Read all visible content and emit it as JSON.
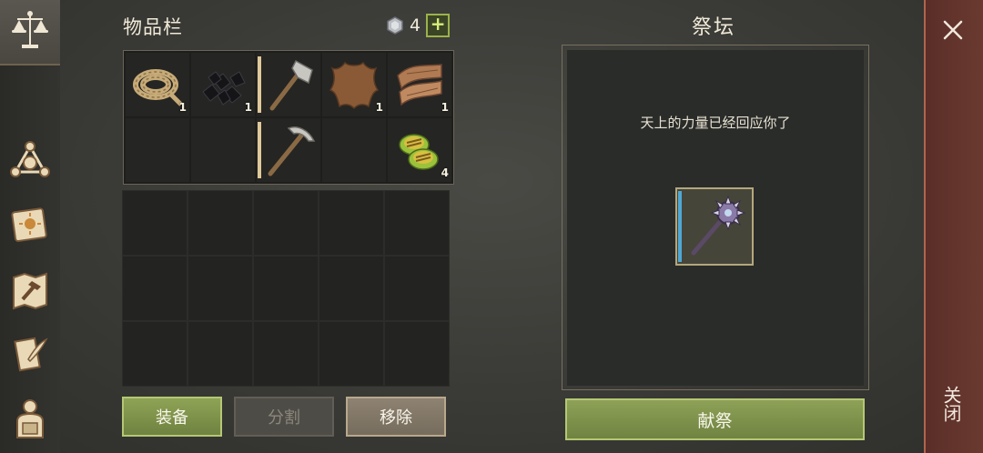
{
  "inventory": {
    "title": "物品栏",
    "currency": {
      "icon": "silver-coin-icon",
      "count": "4",
      "add_label": "+"
    },
    "items": [
      {
        "name": "rope",
        "qty": "1"
      },
      {
        "name": "coal",
        "qty": "1"
      },
      {
        "name": "stone-axe",
        "qty": ""
      },
      {
        "name": "leather-hide",
        "qty": "1"
      },
      {
        "name": "cloth",
        "qty": "1"
      },
      {
        "name": "empty",
        "qty": ""
      },
      {
        "name": "empty",
        "qty": ""
      },
      {
        "name": "stone-pickaxe",
        "qty": ""
      },
      {
        "name": "empty",
        "qty": ""
      },
      {
        "name": "cooked-vegetables",
        "qty": "4"
      }
    ],
    "buttons": {
      "equip": "装备",
      "split": "分割",
      "remove": "移除"
    }
  },
  "altar": {
    "title": "祭坛",
    "message": "天上的力量已经回应你了",
    "offered_item": "spiked-mace",
    "sacrifice_label": "献祭"
  },
  "close": {
    "label": "关闭"
  },
  "sidebar": [
    "scales-icon",
    "triangle-nodes-icon",
    "sun-book-icon",
    "crafting-map-icon",
    "scroll-quill-icon",
    "backpack-character-icon"
  ]
}
